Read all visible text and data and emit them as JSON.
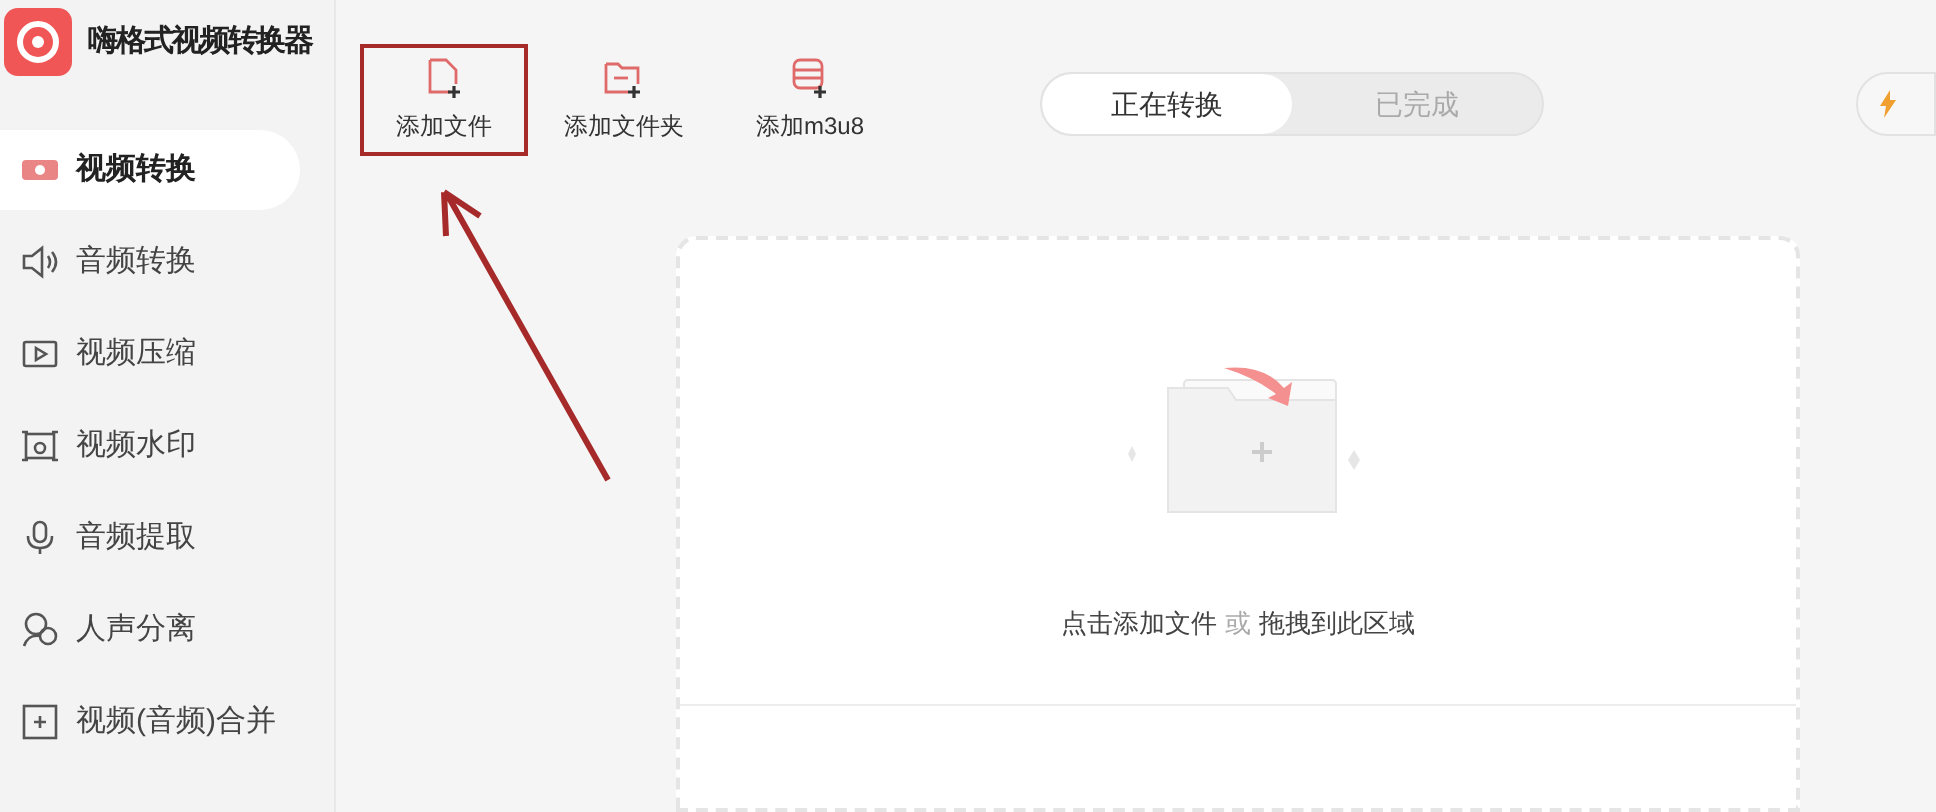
{
  "app": {
    "title": "嗨格式视频转换器"
  },
  "sidebar": {
    "items": [
      {
        "label": "视频转换",
        "kind": "video",
        "selected": true
      },
      {
        "label": "音频转换",
        "kind": "speaker",
        "selected": false
      },
      {
        "label": "视频压缩",
        "kind": "play",
        "selected": false
      },
      {
        "label": "视频水印",
        "kind": "frame",
        "selected": false
      },
      {
        "label": "音频提取",
        "kind": "mic",
        "selected": false
      },
      {
        "label": "人声分离",
        "kind": "voice",
        "selected": false
      },
      {
        "label": "视频(音频)合并",
        "kind": "merge",
        "selected": false
      }
    ]
  },
  "toolbar": [
    {
      "label": "添加文件",
      "kind": "file",
      "annotated": true
    },
    {
      "label": "添加文件夹",
      "kind": "folder",
      "annotated": false
    },
    {
      "label": "添加m3u8",
      "kind": "m3u8",
      "annotated": false
    }
  ],
  "tabs": [
    {
      "label": "正在转换",
      "selected": true
    },
    {
      "label": "已完成",
      "selected": false
    }
  ],
  "dropzone": {
    "text": "点击添加文件",
    "or": "或",
    "text2": "拖拽到此区域"
  }
}
